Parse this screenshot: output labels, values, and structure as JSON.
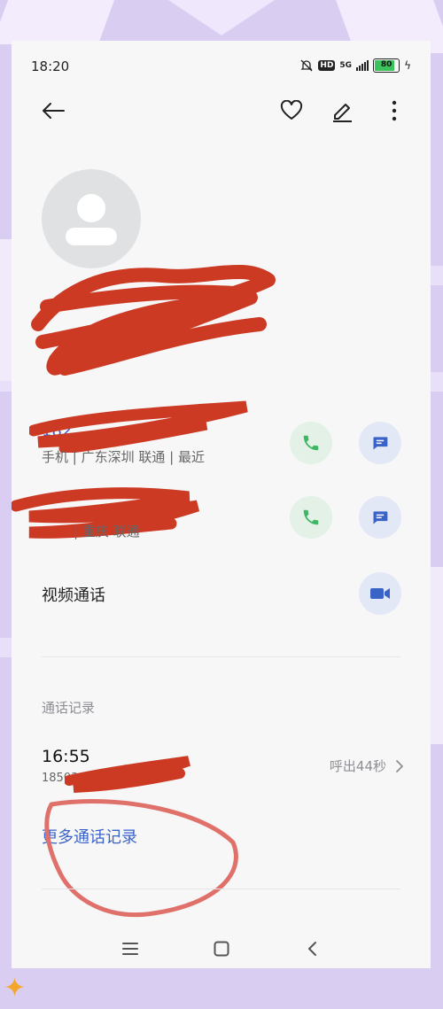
{
  "status_bar": {
    "time": "18:20",
    "hd": "HD",
    "network": "5G",
    "battery": "80"
  },
  "contact": {
    "phone1": {
      "number_partial": "182",
      "meta": "手机 | 广东深圳 联通 | 最近"
    },
    "phone2": {
      "meta": "| 重庆 联通"
    },
    "video_call_label": "视频通话"
  },
  "call_log": {
    "section_title": "通话记录",
    "entries": [
      {
        "time": "16:55",
        "number": "185030",
        "detail": "呼出44秒"
      }
    ],
    "more_link": "更多通话记录"
  },
  "colors": {
    "accent_blue": "#3a63c8",
    "call_green": "#3db764",
    "redaction_red": "#cc3a24"
  },
  "icons": [
    "back-arrow-icon",
    "heart-icon",
    "pencil-icon",
    "more-vertical-icon",
    "person-icon",
    "phone-icon",
    "message-icon",
    "video-icon",
    "chevron-right-icon",
    "menu-icon",
    "home-square-icon",
    "back-chevron-icon"
  ]
}
